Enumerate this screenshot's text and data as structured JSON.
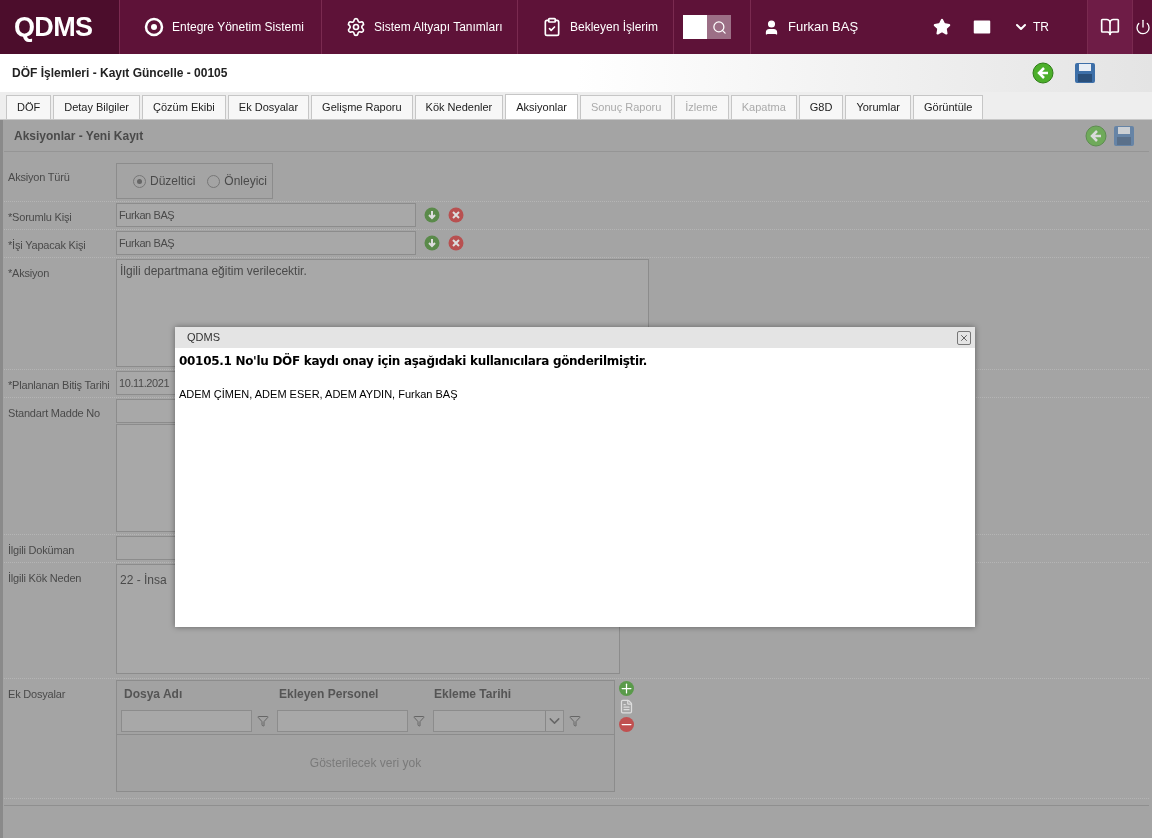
{
  "header": {
    "logo": "QDMS",
    "nav": [
      {
        "label": "Entegre Yönetim Sistemi",
        "kind": "q"
      },
      {
        "label": "Sistem Altyapı Tanımları",
        "kind": "gear"
      },
      {
        "label": "Bekleyen İşlerim",
        "kind": "clipboard"
      }
    ],
    "user": "Furkan BAŞ",
    "language": "TR"
  },
  "page_title": "DÖF İşlemleri - Kayıt Güncelle - 00105",
  "tabs": [
    {
      "label": "DÖF",
      "selected": false,
      "disabled": false
    },
    {
      "label": "Detay Bilgiler",
      "selected": false,
      "disabled": false
    },
    {
      "label": "Çözüm Ekibi",
      "selected": false,
      "disabled": false
    },
    {
      "label": "Ek Dosyalar",
      "selected": false,
      "disabled": false
    },
    {
      "label": "Gelişme Raporu",
      "selected": false,
      "disabled": false
    },
    {
      "label": "Kök Nedenler",
      "selected": false,
      "disabled": false
    },
    {
      "label": "Aksiyonlar",
      "selected": true,
      "disabled": false
    },
    {
      "label": "Sonuç Raporu",
      "selected": false,
      "disabled": true
    },
    {
      "label": "İzleme",
      "selected": false,
      "disabled": true
    },
    {
      "label": "Kapatma",
      "selected": false,
      "disabled": true
    },
    {
      "label": "G8D",
      "selected": false,
      "disabled": false
    },
    {
      "label": "Yorumlar",
      "selected": false,
      "disabled": false
    },
    {
      "label": "Görüntüle",
      "selected": false,
      "disabled": false
    }
  ],
  "form": {
    "title": "Aksiyonlar - Yeni Kayıt",
    "fields": [
      {
        "kind": "radio",
        "label": "Aksiyon Türü",
        "options": [
          {
            "label": "Düzeltici",
            "selected": true
          },
          {
            "label": "Önleyici",
            "selected": false
          }
        ]
      },
      {
        "kind": "person",
        "label": "*Sorumlu Kişi",
        "value": "Furkan BAŞ"
      },
      {
        "kind": "person",
        "label": "*İşi Yapacak Kişi",
        "value": "Furkan BAŞ"
      },
      {
        "kind": "textarea",
        "label": "*Aksiyon",
        "value": "İlgili departmana eğitim verilecektir."
      },
      {
        "kind": "input",
        "label": "*Planlanan Bitiş Tarihi",
        "value": "10.11.2021"
      },
      {
        "kind": "input_list",
        "label": "Standart Madde No"
      },
      {
        "kind": "input",
        "label": "İlgili Doküman"
      },
      {
        "kind": "textarea_short",
        "label": "İlgili Kök Neden",
        "value": "22 - İnsa"
      },
      {
        "kind": "grid",
        "label": "Ek Dosyalar",
        "columns": [
          {
            "label": "Dosya Adı",
            "kind": "text"
          },
          {
            "label": "Ekleyen Personel",
            "kind": "text"
          },
          {
            "label": "Ekleme Tarihi",
            "kind": "date"
          }
        ],
        "empty_text": "Gösterilecek veri yok"
      }
    ]
  },
  "modal": {
    "title": "QDMS",
    "message": "00105.1 No'lu DÖF kaydı onay için aşağıdaki kullanıcılara gönderilmiştir.",
    "recipients": "ADEM ÇİMEN, ADEM ESER, ADEM AYDIN, Furkan BAŞ"
  }
}
